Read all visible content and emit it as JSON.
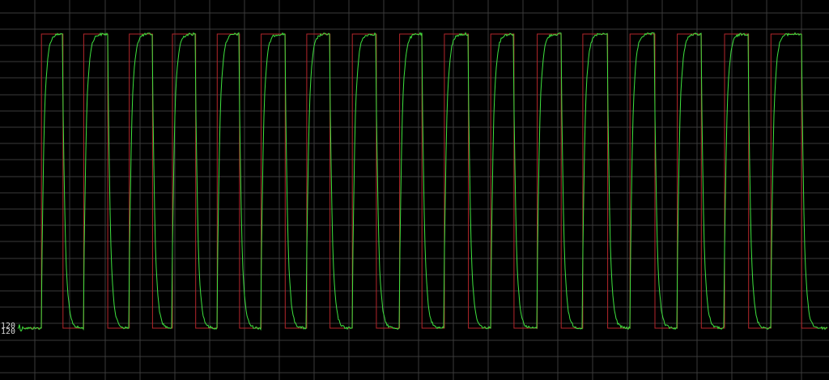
{
  "chart_data": {
    "type": "line",
    "title": "",
    "xlabel": "",
    "ylabel": "",
    "grid": true,
    "legend": "none",
    "colors": {
      "background": "#000000",
      "grid": "#3a3a3a",
      "reference": "#b3262b",
      "measured": "#3ee23e",
      "text": "#d8d8d8"
    },
    "y_ticks": [
      {
        "label": "120"
      },
      {
        "label": "120"
      }
    ],
    "reference_square_wave": {
      "low_level": "low",
      "high_level": "high",
      "rising_edges_frac": [
        0.05,
        0.101,
        0.156,
        0.208,
        0.262,
        0.315,
        0.37,
        0.425,
        0.482,
        0.536,
        0.592,
        0.648,
        0.703,
        0.76,
        0.817,
        0.874,
        0.93
      ],
      "falling_edges_frac": [
        0.076,
        0.13,
        0.184,
        0.236,
        0.289,
        0.344,
        0.398,
        0.454,
        0.509,
        0.565,
        0.62,
        0.677,
        0.733,
        0.79,
        0.846,
        0.903,
        0.967
      ]
    },
    "series": [
      {
        "role": "reference",
        "style": "square wave"
      },
      {
        "role": "measured",
        "style": "noisy response with overshoot and exponential settle"
      }
    ]
  }
}
